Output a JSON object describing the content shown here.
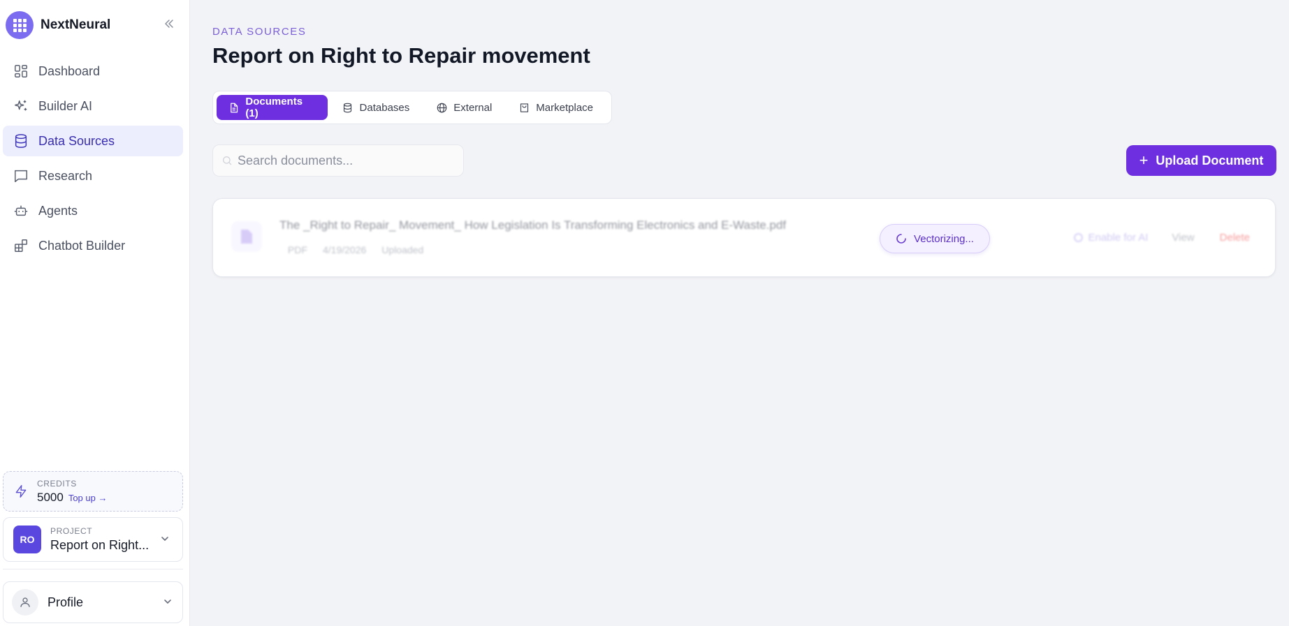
{
  "app": {
    "name": "NextNeural"
  },
  "sidebar": {
    "items": [
      {
        "label": "Dashboard",
        "icon": "layout-grid-icon"
      },
      {
        "label": "Builder AI",
        "icon": "sparkles-icon"
      },
      {
        "label": "Data Sources",
        "icon": "database-icon",
        "active": true
      },
      {
        "label": "Research",
        "icon": "message-square-icon"
      },
      {
        "label": "Agents",
        "icon": "bot-icon"
      },
      {
        "label": "Chatbot Builder",
        "icon": "blocks-icon"
      }
    ],
    "credits": {
      "caption": "CREDITS",
      "value": "5000",
      "topup": "Top up →"
    },
    "project": {
      "caption": "PROJECT",
      "initials": "RO",
      "name": "Report on Right..."
    },
    "profile": {
      "label": "Profile"
    }
  },
  "main": {
    "breadcrumb": "DATA SOURCES",
    "title": "Report on Right to Repair movement",
    "tabs": [
      {
        "label": "Documents (1)",
        "icon": "file-text-icon",
        "active": true
      },
      {
        "label": "Databases",
        "icon": "database-icon"
      },
      {
        "label": "External",
        "icon": "globe-icon"
      },
      {
        "label": "Marketplace",
        "icon": "shopping-bag-icon"
      }
    ],
    "search": {
      "placeholder": "Search documents..."
    },
    "upload_label": "Upload Document",
    "documents": [
      {
        "name": "The _Right to Repair_ Movement_ How Legislation Is Transforming Electronics and E-Waste.pdf",
        "type": "PDF",
        "date": "4/19/2026",
        "status": "Uploaded",
        "enable_label": "Enable for AI",
        "view_label": "View",
        "delete_label": "Delete"
      }
    ],
    "overlay": {
      "label": "Vectorizing..."
    }
  },
  "colors": {
    "accent": "#6d2fe0",
    "active_nav_bg": "#eceefd",
    "page_bg": "#f2f3f6",
    "delete": "#ef4b4b"
  }
}
